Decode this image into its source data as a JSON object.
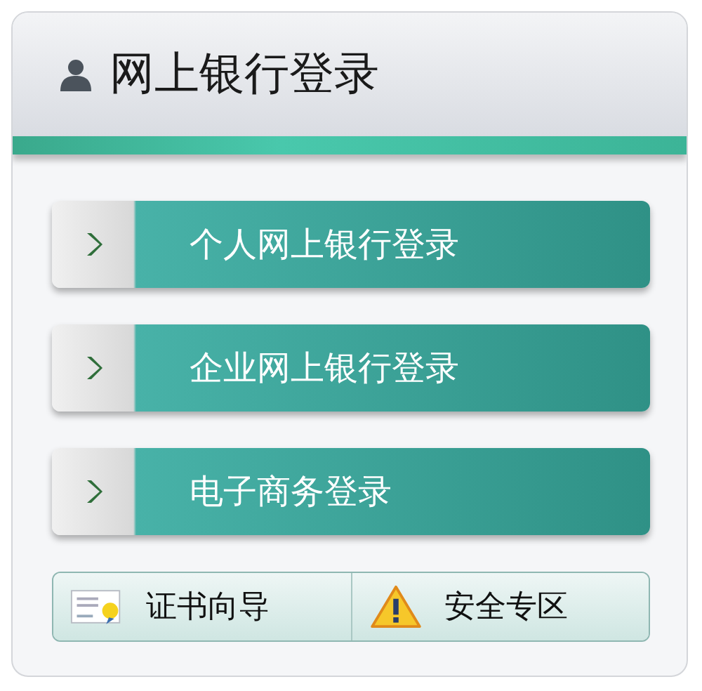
{
  "panel": {
    "title": "网上银行登录"
  },
  "login_buttons": [
    {
      "label": "个人网上银行登录"
    },
    {
      "label": "企业网上银行登录"
    },
    {
      "label": "电子商务登录"
    }
  ],
  "bottom_buttons": [
    {
      "kind": "certificate",
      "label": "证书向导"
    },
    {
      "kind": "warning",
      "label": "安全专区"
    }
  ]
}
